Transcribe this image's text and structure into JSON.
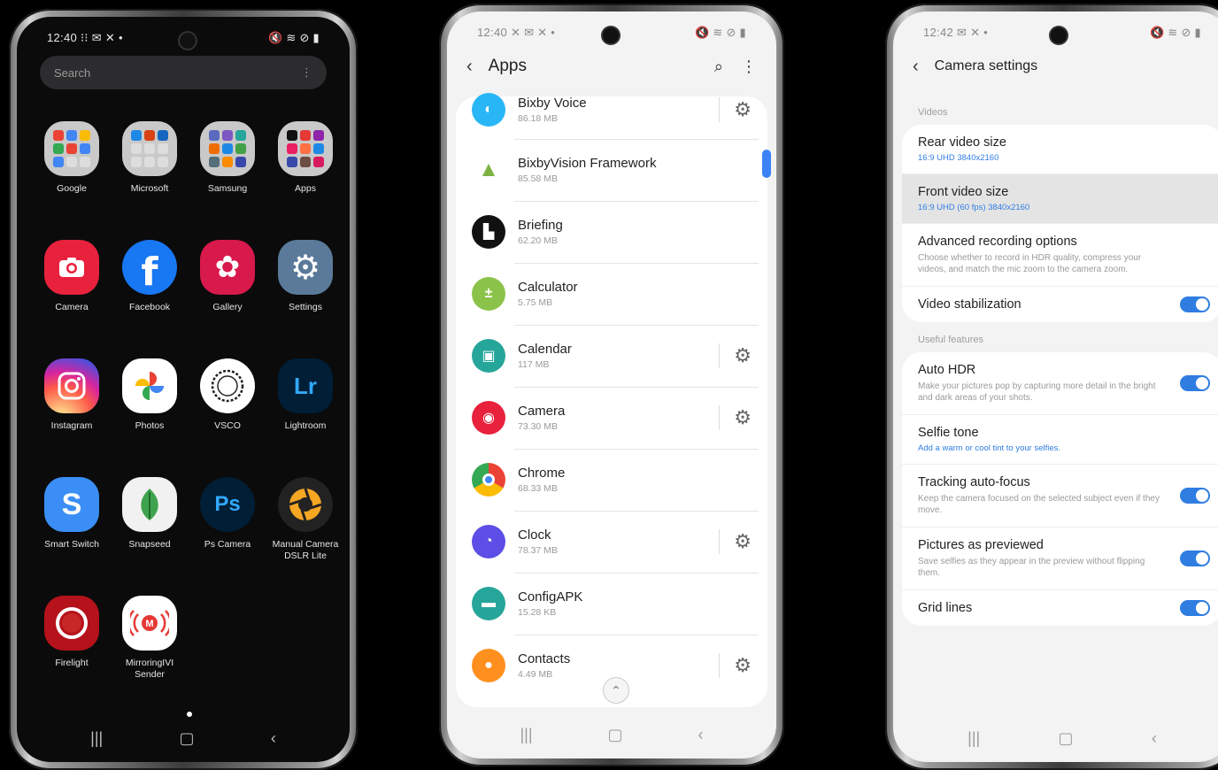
{
  "phone1": {
    "status_time": "12:40",
    "status_left_icons": "⁝⁝ ✉ ✕ •",
    "status_right_icons": "🔇 ≋ ⊘ ▮",
    "search_placeholder": "Search",
    "search_menu": "⋮",
    "apps": [
      {
        "label": "Google"
      },
      {
        "label": "Microsoft"
      },
      {
        "label": "Samsung"
      },
      {
        "label": "Apps"
      },
      {
        "label": "Camera"
      },
      {
        "label": "Facebook"
      },
      {
        "label": "Gallery"
      },
      {
        "label": "Settings"
      },
      {
        "label": "Instagram"
      },
      {
        "label": "Photos"
      },
      {
        "label": "VSCO"
      },
      {
        "label": "Lightroom"
      },
      {
        "label": "Smart Switch"
      },
      {
        "label": "Snapseed"
      },
      {
        "label": "Ps Camera"
      },
      {
        "label": "Manual Camera DSLR Lite"
      },
      {
        "label": "Firelight"
      },
      {
        "label": "MirroringIVI Sender"
      }
    ],
    "nav": {
      "recents": "|||",
      "home": "▢",
      "back": "‹"
    }
  },
  "phone2": {
    "status_time": "12:40",
    "status_left_icons": "✕ ✉ ✕ •",
    "status_right_icons": "🔇 ≋ ⊘ ▮",
    "title": "Apps",
    "back": "‹",
    "search_icon": "⌕",
    "menu_icon": "⋮",
    "items": [
      {
        "name": "Bixby Voice",
        "size": "86.18 MB"
      },
      {
        "name": "BixbyVision Framework",
        "size": "85.58 MB"
      },
      {
        "name": "Briefing",
        "size": "62.20 MB"
      },
      {
        "name": "Calculator",
        "size": "5.75 MB"
      },
      {
        "name": "Calendar",
        "size": "117 MB"
      },
      {
        "name": "Camera",
        "size": "73.30 MB"
      },
      {
        "name": "Chrome",
        "size": "68.33 MB"
      },
      {
        "name": "Clock",
        "size": "78.37 MB"
      },
      {
        "name": "ConfigAPK",
        "size": "15.28 KB"
      },
      {
        "name": "Contacts",
        "size": "4.49 MB"
      }
    ],
    "gear": "⚙",
    "scroll_top": "⌃",
    "nav": {
      "recents": "|||",
      "home": "▢",
      "back": "‹"
    }
  },
  "phone3": {
    "status_time": "12:42",
    "status_left_icons": "✉ ✕ •",
    "status_right_icons": "🔇 ≋ ⊘ ▮",
    "title": "Camera settings",
    "back": "‹",
    "sections": {
      "videos": "Videos",
      "useful": "Useful features"
    },
    "rear_video": {
      "title": "Rear video size",
      "value": "16:9 UHD 3840x2160"
    },
    "front_video": {
      "title": "Front video size",
      "value": "16:9 UHD (60 fps) 3840x2160"
    },
    "advanced": {
      "title": "Advanced recording options",
      "desc": "Choose whether to record in HDR quality, compress your videos, and match the mic zoom to the camera zoom."
    },
    "stabilization": {
      "title": "Video stabilization",
      "on": true
    },
    "auto_hdr": {
      "title": "Auto HDR",
      "desc": "Make your pictures pop by capturing more detail in the bright and dark areas of your shots.",
      "on": true
    },
    "selfie_tone": {
      "title": "Selfie tone",
      "value": "Add a warm or cool tint to your selfies."
    },
    "tracking": {
      "title": "Tracking auto-focus",
      "desc": "Keep the camera focused on the selected subject even if they move.",
      "on": true
    },
    "previewed": {
      "title": "Pictures as previewed",
      "desc": "Save selfies as they appear in the preview without flipping them.",
      "on": true
    },
    "grid": {
      "title": "Grid lines",
      "on": true
    },
    "nav": {
      "recents": "|||",
      "home": "▢",
      "back": "‹"
    }
  },
  "colors": {
    "accent_blue": "#2f7de1",
    "drawer_bg": "#0b0b0b",
    "settings_bg": "#f3f3f3"
  }
}
